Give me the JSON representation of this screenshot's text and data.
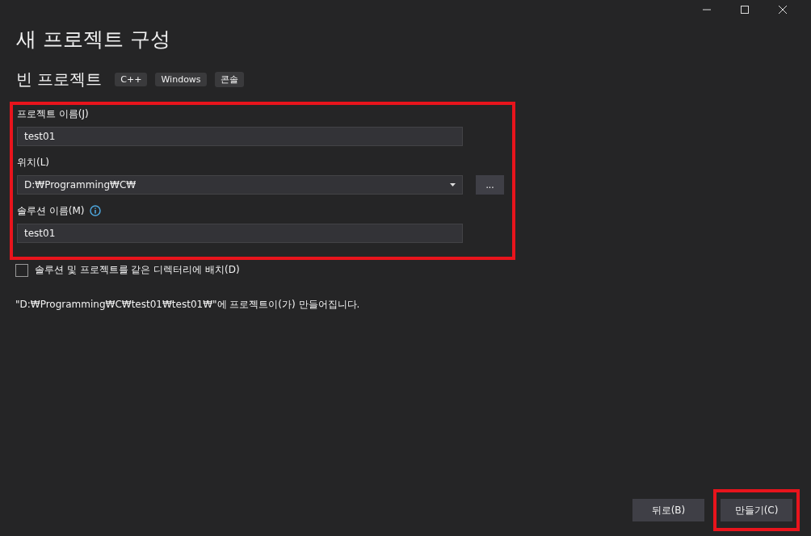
{
  "title": "새 프로젝트 구성",
  "template": {
    "name": "빈 프로젝트",
    "tags": [
      "C++",
      "Windows",
      "콘솔"
    ]
  },
  "form": {
    "highlighted": true,
    "project_name": {
      "label": "프로젝트 이름(J)",
      "value": "test01"
    },
    "location": {
      "label": "위치(L)",
      "value": "D:₩Programming₩C₩",
      "browse": "..."
    },
    "solution_name": {
      "label": "솔루션 이름(M)",
      "value": "test01"
    }
  },
  "same_directory": {
    "label": "솔루션 및 프로젝트를 같은 디렉터리에 배치(D)",
    "checked": false
  },
  "path_note": "\"D:₩Programming₩C₩test01₩test01₩\"에 프로젝트이(가) 만들어집니다.",
  "buttons": [
    {
      "label": "뒤로(B)",
      "highlighted": false
    },
    {
      "label": "만들기(C)",
      "highlighted": true
    }
  ]
}
